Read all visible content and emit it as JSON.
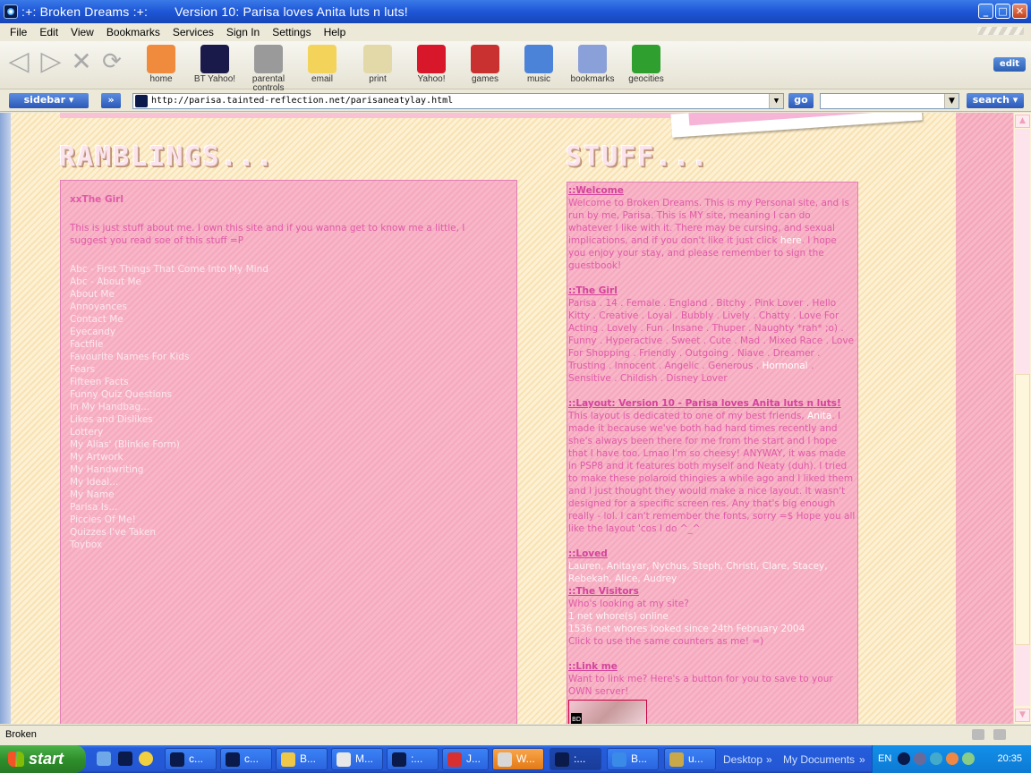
{
  "window": {
    "title": ":+: Broken Dreams :+:",
    "subtitle": "Version 10: Parisa loves Anita luts n luts!",
    "buttons": [
      "_",
      "□",
      "✕"
    ]
  },
  "menu": [
    "File",
    "Edit",
    "View",
    "Bookmarks",
    "Services",
    "Sign In",
    "Settings",
    "Help"
  ],
  "toolbar": {
    "items": [
      {
        "label": "home",
        "icon": "home-icon",
        "color": "#f08a3c"
      },
      {
        "label": "BT Yahoo!",
        "icon": "bt-yahoo-icon",
        "color": "#1a1a4a"
      },
      {
        "label": "parental controls",
        "icon": "padlock-icon",
        "color": "#9a9a9a"
      },
      {
        "label": "email",
        "icon": "envelope-icon",
        "color": "#f3d35a"
      },
      {
        "label": "print",
        "icon": "printer-icon",
        "color": "#e3d8a8"
      },
      {
        "label": "Yahoo!",
        "icon": "yahoo-icon",
        "color": "#d8182a"
      },
      {
        "label": "games",
        "icon": "joystick-icon",
        "color": "#c93030"
      },
      {
        "label": "music",
        "icon": "music-note-icon",
        "color": "#4b83d8"
      },
      {
        "label": "bookmarks",
        "icon": "book-icon",
        "color": "#8aa0d8"
      },
      {
        "label": "geocities",
        "icon": "globe-icon",
        "color": "#2fa02f"
      }
    ],
    "edit_label": "edit"
  },
  "address": {
    "sidebar_label": "sidebar",
    "forward_label": "»",
    "url": "http://parisa.tainted-reflection.net/parisaneatylay.html",
    "go_label": "go",
    "search_label": "search"
  },
  "page": {
    "ramblings_heading": "RAMBLINGS...",
    "stuff_heading": "STUFF...",
    "left": {
      "title": "xxThe Girl",
      "intro": "This is just stuff about me. I own this site and if you wanna get to know me a little, I suggest you read soe of this stuff =P",
      "links": [
        "Abc - First Things That Come Into My Mind",
        "Abc - About Me",
        "About Me",
        "Annoyances",
        "Contact Me",
        "Eyecandy",
        "Factfile",
        "Favourite Names For Kids",
        "Fears",
        "Fifteen Facts",
        "Funny Quiz Questions",
        "In My Handbag...",
        "Likes and Dislikes",
        "Lottery",
        "My Alias' (Blinkie Form)",
        "My Artwork",
        "My Handwriting",
        "My Ideal...",
        "My Name",
        "Parisa Is...",
        "Piccies Of Me!",
        "Quizzes I've Taken",
        "Toybox"
      ]
    },
    "right": {
      "welcome_h": "::Welcome",
      "welcome_p1": "Welcome to Broken Dreams. This is my Personal site, and is run by me, Parisa. This is MY site, meaning I can do whatever I like with it. There may be cursing, and sexual implications, and if you don't like it just click ",
      "welcome_here": "here",
      "welcome_p2": ". I hope you enjoy your stay, and please remember to sign the guestbook!",
      "girl_h": "::The Girl",
      "girl_p1": "Parisa . 14 . Female . England . Bitchy . Pink Lover . Hello Kitty . Creative . Loyal . Bubbly . Lively . Chatty . Love For Acting . Lovely . Fun . Insane . Thuper . Naughty *rah* ;o) . Funny . Hyperactive . Sweet . Cute . Mad . Mixed Race . Love For Shopping . Friendly . Outgoing . Niave . Dreamer . Trusting . Innocent . Angelic . Generous . ",
      "girl_hormonal": "Hormonal",
      "girl_p2": " . Sensitive . Childish . Disney Lover",
      "layout_h": "::Layout: Version 10 - Parisa loves Anita luts n luts!",
      "layout_p1": "This layout is dedicated to one of my best friends, ",
      "layout_anita": "Anita",
      "layout_p2": ". I made it because we've both had hard times recently and she's always been there for me from the start and I hope that I have too. Lmao I'm so cheesy! ANYWAY, it was made in PSP8 and it features both myself and Neaty (duh). I tried to make these polaroid thingies a while ago and I liked them and I just thought they would make a nice layout. It wasn't designed for a specific screen res. Any that's big enough really - lol. I can't remember the fonts, sorry =$ Hope you all like the layout 'cos I do ^_^",
      "loved_h": "::Loved",
      "loved_p": "Lauren, Anitayar, Nychus, Steph, Christi, Clare, Stacey, Rebekah, Alice, Audrey",
      "visitors_h": "::The Visitors",
      "visitors_q": "Who's looking at my site?",
      "visitors_online": "1 net whore(s) online",
      "visitors_count": "1536 net whores looked since 24th February 2004",
      "visitors_click": "Click to use the same counters as me! =)",
      "link_h": "::Link me",
      "link_p": "Want to link me? Here's a button for you to save to your OWN server!",
      "button_tag": "BD"
    }
  },
  "status": {
    "text": "Broken"
  },
  "taskbar": {
    "start_label": "start",
    "tasks": [
      {
        "label": "c...",
        "color": "#0a1a4a"
      },
      {
        "label": "c...",
        "color": "#0a1a4a"
      },
      {
        "label": "B...",
        "color": "#f0c848"
      },
      {
        "label": "M...",
        "color": "#e8e8e8"
      },
      {
        "label": ":...",
        "color": "#0a1a4a"
      },
      {
        "label": "J...",
        "color": "#d83030"
      },
      {
        "label": "W...",
        "color": "#d8d8d8"
      },
      {
        "label": ":...",
        "color": "#0a1a4a"
      },
      {
        "label": "B...",
        "color": "#3a8ae8"
      },
      {
        "label": "u...",
        "color": "#c8a848"
      }
    ],
    "desktop_label": "Desktop",
    "documents_label": "My Documents",
    "lang": "EN",
    "clock": "20:35"
  }
}
